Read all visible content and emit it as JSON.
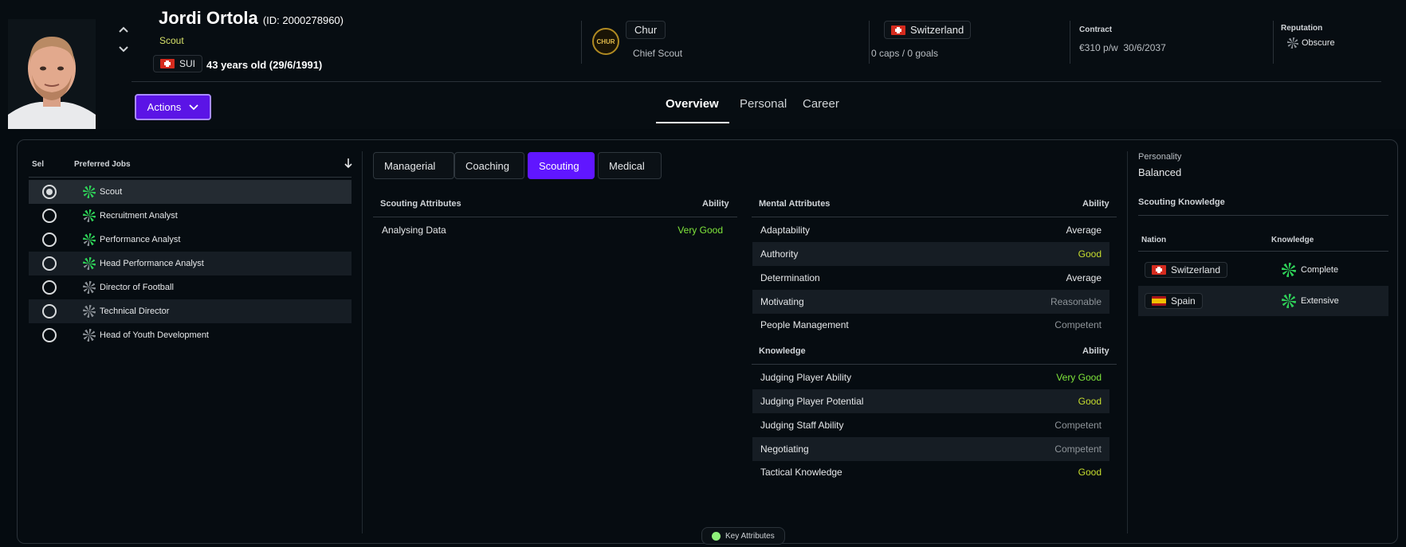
{
  "header": {
    "name": "Jordi Ortola",
    "id_text": "(ID: 2000278960)",
    "role": "Scout",
    "nationality_code": "SUI",
    "age_text": "43 years old (29/6/1991)",
    "club_name": "Chur",
    "club_logo_text": "CHUR",
    "club_position": "Chief Scout",
    "nation_name": "Switzerland",
    "caps_goals": "0 caps / 0 goals",
    "contract_label": "Contract",
    "contract_value": "€310 p/w  30/6/2037",
    "reputation_label": "Reputation",
    "reputation_value": "Obscure",
    "actions_label": "Actions",
    "nav_tabs": [
      "Overview",
      "Personal",
      "Career"
    ]
  },
  "jobs": {
    "sel_header": "Sel",
    "jobs_header": "Preferred Jobs",
    "items": [
      {
        "label": "Scout",
        "icon": "green-rating-wheel-icon"
      },
      {
        "label": "Recruitment Analyst",
        "icon": "mixed-rating-wheel-icon"
      },
      {
        "label": "Performance Analyst",
        "icon": "mixed-rating-wheel-icon"
      },
      {
        "label": "Head Performance Analyst",
        "icon": "mixed-rating-wheel-icon"
      },
      {
        "label": "Director of Football",
        "icon": "grey-rating-wheel-icon"
      },
      {
        "label": "Technical Director",
        "icon": "grey-rating-wheel-icon"
      },
      {
        "label": "Head of Youth Development",
        "icon": "grey-rating-wheel-icon"
      }
    ]
  },
  "subtabs": [
    "Managerial",
    "Coaching",
    "Scouting",
    "Medical"
  ],
  "scouting": {
    "title": "Scouting Attributes",
    "ability_header": "Ability",
    "rows": [
      {
        "name": "Analysing Data",
        "value": "Very Good"
      }
    ]
  },
  "mental": {
    "title": "Mental Attributes",
    "ability_header": "Ability",
    "rows": [
      {
        "name": "Adaptability",
        "value": "Average"
      },
      {
        "name": "Authority",
        "value": "Good"
      },
      {
        "name": "Determination",
        "value": "Average"
      },
      {
        "name": "Motivating",
        "value": "Reasonable"
      },
      {
        "name": "People Management",
        "value": "Competent"
      }
    ]
  },
  "knowledge": {
    "title": "Knowledge",
    "ability_header": "Ability",
    "rows": [
      {
        "name": "Judging Player Ability",
        "value": "Very Good"
      },
      {
        "name": "Judging Player Potential",
        "value": "Good"
      },
      {
        "name": "Judging Staff Ability",
        "value": "Competent"
      },
      {
        "name": "Negotiating",
        "value": "Competent"
      },
      {
        "name": "Tactical Knowledge",
        "value": "Good"
      }
    ]
  },
  "side": {
    "personality_label": "Personality",
    "personality_value": "Balanced",
    "scouting_knowledge_title": "Scouting Knowledge",
    "nation_header": "Nation",
    "knowledge_header": "Knowledge",
    "rows": [
      {
        "nation": "Switzerland",
        "knowledge": "Complete"
      },
      {
        "nation": "Spain",
        "knowledge": "Extensive"
      }
    ]
  },
  "footer": {
    "key_attributes_label": "Key Attributes"
  },
  "colors": {
    "accent": "#6016ff",
    "very_good": "#7fe53b",
    "good": "#c7dd2e",
    "role": "#d7e26a"
  }
}
